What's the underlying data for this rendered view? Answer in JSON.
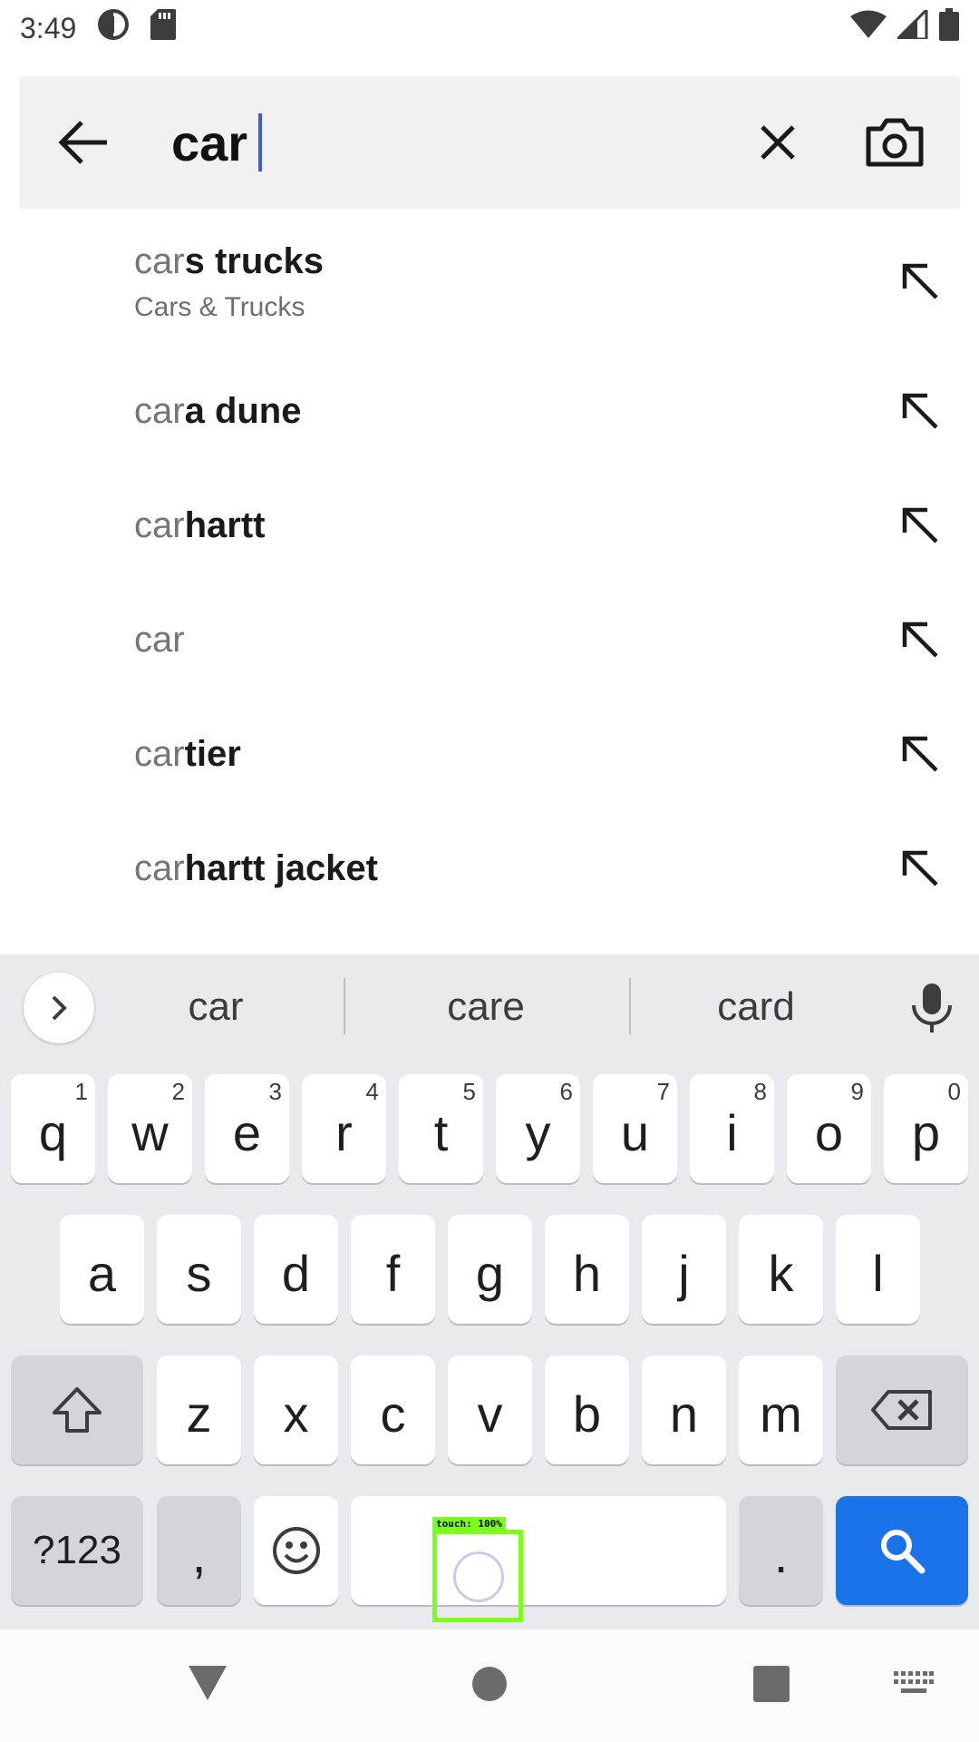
{
  "status_bar": {
    "time": "3:49",
    "icons": [
      "data-saver-icon",
      "sd-card-icon",
      "wifi-icon",
      "signal-icon",
      "battery-icon"
    ]
  },
  "search": {
    "query": "car",
    "back_icon": "arrow-back-icon",
    "clear_icon": "close-icon",
    "camera_icon": "camera-icon"
  },
  "suggestions": [
    {
      "typed": "car",
      "rest": "s trucks",
      "subtitle": "Cars & Trucks"
    },
    {
      "typed": "car",
      "rest": "a dune",
      "subtitle": ""
    },
    {
      "typed": "car",
      "rest": "hartt",
      "subtitle": ""
    },
    {
      "typed": "car",
      "rest": "",
      "subtitle": ""
    },
    {
      "typed": "car",
      "rest": "tier",
      "subtitle": ""
    },
    {
      "typed": "car",
      "rest": "hartt jacket",
      "subtitle": ""
    }
  ],
  "keyboard": {
    "suggestions": [
      "car",
      "care",
      "card"
    ],
    "row1": [
      {
        "k": "q",
        "h": "1"
      },
      {
        "k": "w",
        "h": "2"
      },
      {
        "k": "e",
        "h": "3"
      },
      {
        "k": "r",
        "h": "4"
      },
      {
        "k": "t",
        "h": "5"
      },
      {
        "k": "y",
        "h": "6"
      },
      {
        "k": "u",
        "h": "7"
      },
      {
        "k": "i",
        "h": "8"
      },
      {
        "k": "o",
        "h": "9"
      },
      {
        "k": "p",
        "h": "0"
      }
    ],
    "row2": [
      "a",
      "s",
      "d",
      "f",
      "g",
      "h",
      "j",
      "k",
      "l"
    ],
    "row3": [
      "z",
      "x",
      "c",
      "v",
      "b",
      "n",
      "m"
    ],
    "symbols_label": "?123",
    "comma_label": ",",
    "period_label": "."
  },
  "touch_overlay": {
    "label": "touch: 100%"
  },
  "colors": {
    "accent": "#1a73e8",
    "caret": "#3b5bdb",
    "touch_box": "#7cff1a"
  }
}
